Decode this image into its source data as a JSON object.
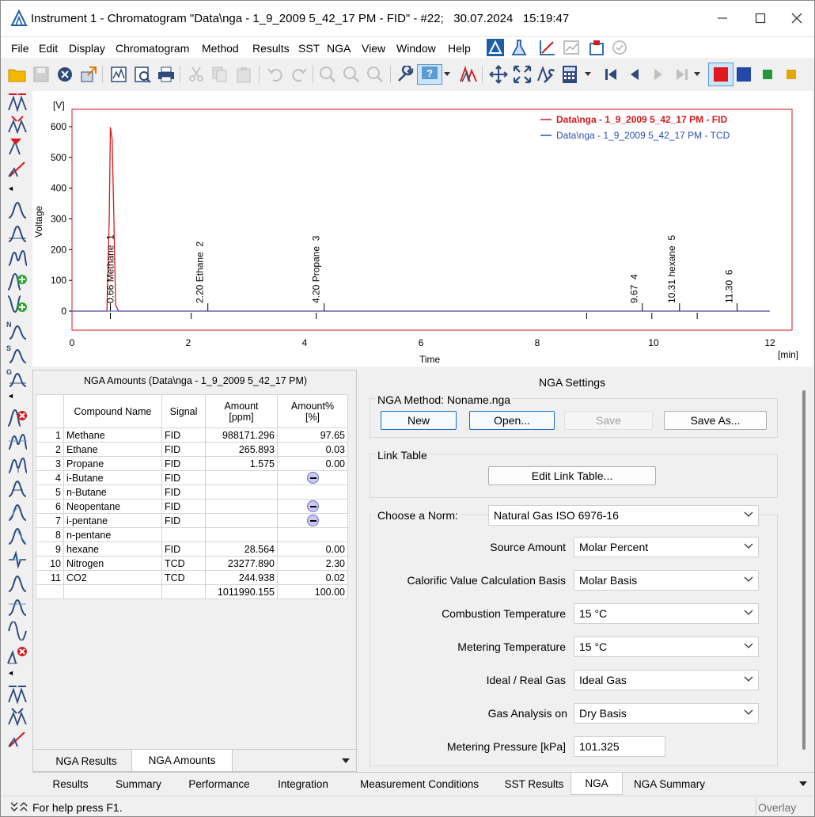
{
  "window": {
    "title": "Instrument 1 - Chromatogram \"Data\\nga - 1_9_2009 5_42_17 PM - FID\" - #22;   30.07.2024   15:19:47"
  },
  "menu": [
    "File",
    "Edit",
    "Display",
    "Chromatogram",
    "Method",
    "Results",
    "SST",
    "NGA",
    "View",
    "Window",
    "Help"
  ],
  "chart": {
    "y_unit": "[V]",
    "x_unit": "[min]",
    "ylabel": "Voltage",
    "xlabel": "Time",
    "y_ticks": [
      "600",
      "500",
      "400",
      "300",
      "200",
      "100",
      "0"
    ],
    "x_ticks": [
      "0",
      "2",
      "4",
      "6",
      "8",
      "10",
      "12"
    ],
    "legend": [
      "Data\\nga - 1_9_2009 5_42_17 PM - FID",
      "Data\\nga - 1_9_2009 5_42_17 PM - TCD"
    ],
    "peak_labels": [
      "0.66 Methane  1",
      "2.20 Ethane  2",
      "4.20 Propane  3",
      "9.67  4",
      "10.31 hexane  5",
      "11.30  6"
    ]
  },
  "chart_data": {
    "type": "line",
    "xlabel": "Time",
    "ylabel": "Voltage",
    "xlim": [
      0,
      12
    ],
    "ylim": [
      0,
      600
    ],
    "series": [
      {
        "name": "Data\\nga - 1_9_2009 5_42_17 PM - FID",
        "color": "#d7191c",
        "x": [
          0.0,
          0.6,
          0.64,
          0.66,
          0.69,
          0.72,
          0.75,
          0.8,
          2.2,
          4.2,
          9.67,
          10.31,
          11.3,
          12.0
        ],
        "y": [
          0,
          0,
          300,
          598,
          560,
          300,
          20,
          0,
          0,
          0,
          0,
          0,
          0,
          0
        ]
      },
      {
        "name": "Data\\nga - 1_9_2009 5_42_17 PM - TCD",
        "color": "#2b4fb5",
        "x": [
          0.0,
          0.6,
          0.75,
          12.0
        ],
        "y": [
          0,
          0,
          0,
          0
        ]
      }
    ],
    "peaks": [
      {
        "time": 0.66,
        "name": "Methane",
        "number": 1
      },
      {
        "time": 2.2,
        "name": "Ethane",
        "number": 2
      },
      {
        "time": 4.2,
        "name": "Propane",
        "number": 3
      },
      {
        "time": 9.67,
        "name": "",
        "number": 4
      },
      {
        "time": 10.31,
        "name": "hexane",
        "number": 5
      },
      {
        "time": 11.3,
        "name": "",
        "number": 6
      }
    ]
  },
  "amounts": {
    "title": "NGA Amounts (Data\\nga - 1_9_2009 5_42_17 PM)",
    "headers": [
      "Compound Name",
      "Signal",
      "Amount\n[ppm]",
      "Amount%\n[%]"
    ],
    "rows": [
      {
        "n": "1",
        "name": "Methane",
        "signal": "FID",
        "amount": "988171.296",
        "pct": "97.65"
      },
      {
        "n": "2",
        "name": "Ethane",
        "signal": "FID",
        "amount": "265.893",
        "pct": "0.03"
      },
      {
        "n": "3",
        "name": "Propane",
        "signal": "FID",
        "amount": "1.575",
        "pct": "0.00"
      },
      {
        "n": "4",
        "name": "i-Butane",
        "signal": "FID",
        "amount": "",
        "pct": "-"
      },
      {
        "n": "5",
        "name": "n-Butane",
        "signal": "FID",
        "amount": "",
        "pct": ""
      },
      {
        "n": "6",
        "name": "Neopentane",
        "signal": "FID",
        "amount": "",
        "pct": "-"
      },
      {
        "n": "7",
        "name": "i-pentane",
        "signal": "FID",
        "amount": "",
        "pct": "-"
      },
      {
        "n": "8",
        "name": "n-pentane",
        "signal": "",
        "amount": "",
        "pct": ""
      },
      {
        "n": "9",
        "name": "hexane",
        "signal": "FID",
        "amount": "28.564",
        "pct": "0.00"
      },
      {
        "n": "10",
        "name": "Nitrogen",
        "signal": "TCD",
        "amount": "23277.890",
        "pct": "2.30"
      },
      {
        "n": "11",
        "name": "CO2",
        "signal": "TCD",
        "amount": "244.938",
        "pct": "0.02"
      }
    ],
    "total_amount": "1011990.155",
    "total_pct": "100.00",
    "tabs": [
      "NGA Results",
      "NGA Amounts"
    ]
  },
  "settings": {
    "title": "NGA Settings",
    "method_label": "NGA Method: Noname.nga",
    "buttons": {
      "new": "New",
      "open": "Open...",
      "save": "Save",
      "save_as": "Save As..."
    },
    "link_table_label": "Link Table",
    "edit_link_table": "Edit Link Table...",
    "norm_label": "Choose a Norm:",
    "norm_value": "Natural Gas ISO 6976-16",
    "fields": [
      {
        "label": "Source Amount",
        "value": "Molar Percent"
      },
      {
        "label": "Calorific Value Calculation Basis",
        "value": "Molar Basis"
      },
      {
        "label": "Combustion Temperature",
        "value": "15 °C"
      },
      {
        "label": "Metering Temperature",
        "value": "15 °C"
      },
      {
        "label": "Ideal / Real Gas",
        "value": "Ideal Gas"
      },
      {
        "label": "Gas Analysis on",
        "value": "Dry Basis"
      }
    ],
    "pressure_label": "Metering Pressure [kPa]",
    "pressure_value": "101.325"
  },
  "bottom_tabs": [
    "Results",
    "Summary",
    "Performance",
    "Integration",
    "Measurement Conditions",
    "SST Results",
    "NGA",
    "NGA Summary"
  ],
  "status": {
    "text": "For help press F1.",
    "overlay": "Overlay"
  }
}
